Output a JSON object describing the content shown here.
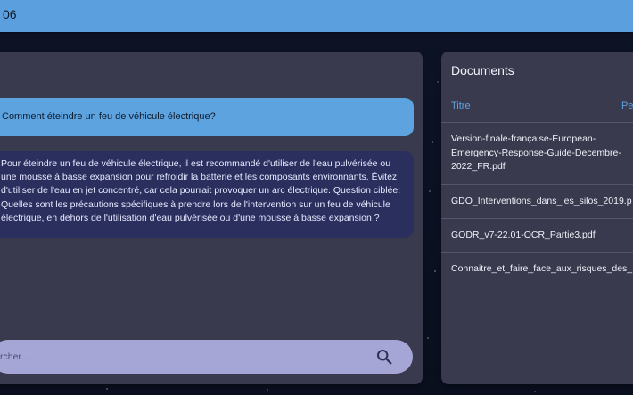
{
  "header": {
    "title": "06"
  },
  "chat": {
    "user_message": "Comment éteindre un feu de véhicule électrique?",
    "bot_lines": [
      "Pour éteindre un feu de véhicule électrique, il est recommandé d'utiliser de l'eau pulvérisée ou",
      "une mousse à basse expansion pour refroidir la batterie et les composants environnants. Évitez",
      "d'utiliser de l'eau en jet concentré, car cela pourrait provoquer un arc électrique. Question ciblée:",
      "Quelles sont les précautions spécifiques à prendre lors de l'intervention sur un feu de véhicule",
      "électrique, en dehors de l'utilisation d'eau pulvérisée ou d'une mousse à basse expansion ?"
    ]
  },
  "search": {
    "placeholder": "rcher...",
    "icon": "search-icon"
  },
  "documents": {
    "title": "Documents",
    "columns": [
      "Titre",
      "Pe"
    ],
    "items": [
      {
        "lines": [
          "Version-finale-française-European-",
          "Emergency-Response-Guide-Decembre-",
          "2022_FR.pdf"
        ]
      },
      {
        "lines": [
          "GDO_Interventions_dans_les_silos_2019.p"
        ]
      },
      {
        "lines": [
          "GODR_v7-22.01-OCR_Partie3.pdf"
        ]
      },
      {
        "lines": [
          "Connaitre_et_faire_face_aux_risques_des_"
        ]
      }
    ]
  }
}
